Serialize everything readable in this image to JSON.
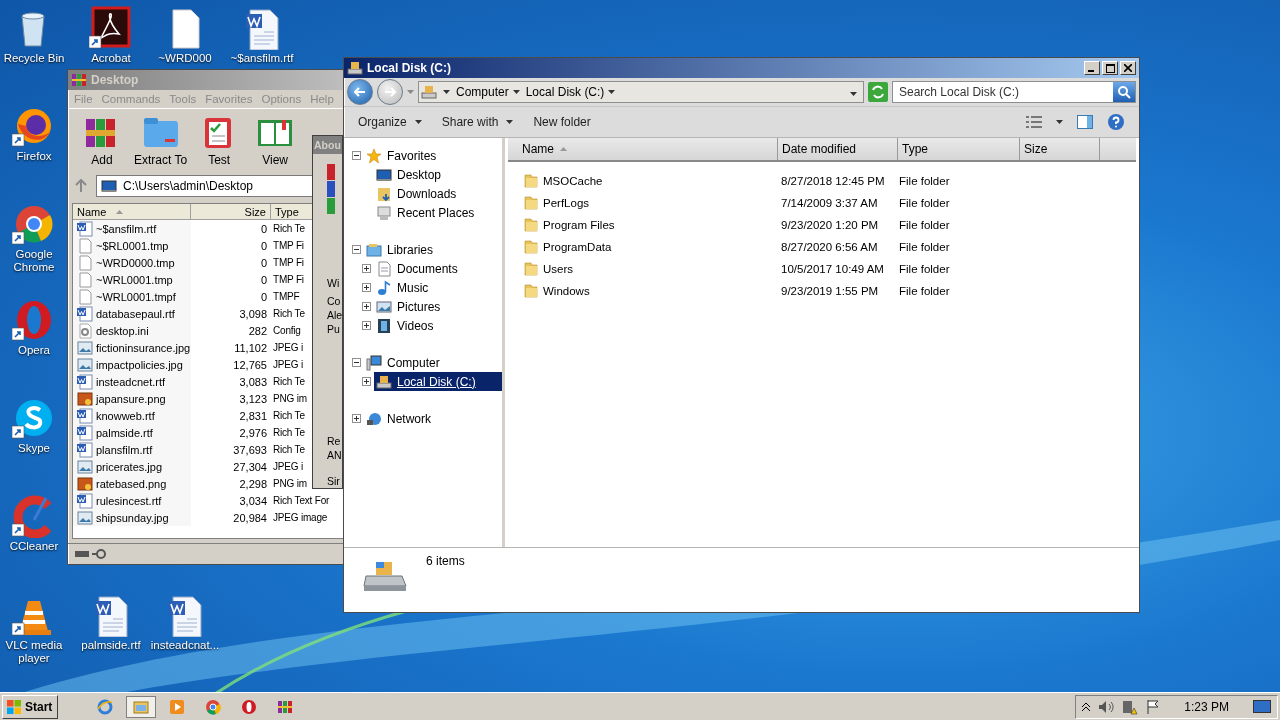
{
  "desktop_icons": [
    {
      "label": "Recycle Bin",
      "kind": "recycle",
      "shortcut": false
    },
    {
      "label": "Acrobat",
      "kind": "acrobat",
      "shortcut": true
    },
    {
      "label": "~WRD000",
      "kind": "blank",
      "shortcut": false
    },
    {
      "label": "~$ansfilm.rtf",
      "kind": "word",
      "shortcut": false
    },
    {
      "label": "Firefox",
      "kind": "firefox",
      "shortcut": true
    },
    {
      "label": "Google Chrome",
      "kind": "chrome",
      "shortcut": true
    },
    {
      "label": "Opera",
      "kind": "opera",
      "shortcut": true
    },
    {
      "label": "Skype",
      "kind": "skype",
      "shortcut": true
    },
    {
      "label": "CCleaner",
      "kind": "ccleaner",
      "shortcut": true
    },
    {
      "label": "VLC media player",
      "kind": "vlc",
      "shortcut": true
    },
    {
      "label": "palmside.rtf",
      "kind": "word",
      "shortcut": false
    },
    {
      "label": "insteadcnat...",
      "kind": "word",
      "shortcut": false
    }
  ],
  "archiver": {
    "title": "Desktop",
    "menu": [
      "File",
      "Commands",
      "Tools",
      "Favorites",
      "Options",
      "Help"
    ],
    "toolbar": [
      {
        "label": "Add",
        "kind": "add"
      },
      {
        "label": "Extract To",
        "kind": "extract"
      },
      {
        "label": "Test",
        "kind": "test"
      },
      {
        "label": "View",
        "kind": "view"
      }
    ],
    "path": "C:\\Users\\admin\\Desktop",
    "columns": [
      "Name",
      "Size",
      "Type"
    ],
    "rows": [
      {
        "name": "~$ansfilm.rtf",
        "kind": "word",
        "size": "0",
        "type": "Rich Te"
      },
      {
        "name": "~$RL0001.tmp",
        "kind": "blank",
        "size": "0",
        "type": "TMP Fi"
      },
      {
        "name": "~WRD0000.tmp",
        "kind": "blank",
        "size": "0",
        "type": "TMP Fi"
      },
      {
        "name": "~WRL0001.tmp",
        "kind": "blank",
        "size": "0",
        "type": "TMP Fi"
      },
      {
        "name": "~WRL0001.tmpf",
        "kind": "blank",
        "size": "0",
        "type": "TMPF"
      },
      {
        "name": "databasepaul.rtf",
        "kind": "word",
        "size": "3,098",
        "type": "Rich Te"
      },
      {
        "name": "desktop.ini",
        "kind": "ini",
        "size": "282",
        "type": "Config"
      },
      {
        "name": "fictioninsurance.jpg",
        "kind": "image",
        "size": "11,102",
        "type": "JPEG i"
      },
      {
        "name": "impactpolicies.jpg",
        "kind": "image",
        "size": "12,765",
        "type": "JPEG i"
      },
      {
        "name": "insteadcnet.rtf",
        "kind": "word",
        "size": "3,083",
        "type": "Rich Te"
      },
      {
        "name": "japansure.png",
        "kind": "png",
        "size": "3,123",
        "type": "PNG im"
      },
      {
        "name": "knowweb.rtf",
        "kind": "word",
        "size": "2,831",
        "type": "Rich Te"
      },
      {
        "name": "palmside.rtf",
        "kind": "word",
        "size": "2,976",
        "type": "Rich Te"
      },
      {
        "name": "plansfilm.rtf",
        "kind": "word",
        "size": "37,693",
        "type": "Rich Te"
      },
      {
        "name": "pricerates.jpg",
        "kind": "image",
        "size": "27,304",
        "type": "JPEG i"
      },
      {
        "name": "ratebased.png",
        "kind": "png",
        "size": "2,298",
        "type": "PNG im"
      },
      {
        "name": "rulesincest.rtf",
        "kind": "word",
        "size": "3,034",
        "type": "Rich Text For"
      },
      {
        "name": "shipsunday.jpg",
        "kind": "image",
        "size": "20,984",
        "type": "JPEG image"
      }
    ]
  },
  "about_dialog": {
    "title": "Abou",
    "groups": [
      [
        "Wi"
      ],
      [
        "Co",
        "Ale",
        "Pu"
      ],
      [
        "Re",
        "AN"
      ],
      [
        "Sir"
      ]
    ]
  },
  "explorer": {
    "title": "Local Disk (C:)",
    "breadcrumbs": [
      "Computer",
      "Local Disk (C:)"
    ],
    "search": {
      "placeholder": "Search Local Disk (C:)"
    },
    "commands": [
      "Organize",
      "Share with",
      "New folder"
    ],
    "nav": [
      {
        "label": "Favorites",
        "kind": "star",
        "expanded": true,
        "selected": false,
        "children": [
          {
            "label": "Desktop",
            "kind": "desktop",
            "selected": false
          },
          {
            "label": "Downloads",
            "kind": "downloads",
            "selected": false
          },
          {
            "label": "Recent Places",
            "kind": "recent",
            "selected": false
          }
        ]
      },
      {
        "label": "Libraries",
        "kind": "library",
        "expanded": true,
        "selected": false,
        "children": [
          {
            "label": "Documents",
            "kind": "documents",
            "expanded": false,
            "selected": false
          },
          {
            "label": "Music",
            "kind": "music",
            "expanded": false,
            "selected": false
          },
          {
            "label": "Pictures",
            "kind": "pictures",
            "expanded": false,
            "selected": false
          },
          {
            "label": "Videos",
            "kind": "videos",
            "expanded": false,
            "selected": false
          }
        ]
      },
      {
        "label": "Computer",
        "kind": "computer",
        "expanded": true,
        "selected": false,
        "children": [
          {
            "label": "Local Disk (C:)",
            "kind": "disk",
            "expanded": false,
            "selected": true
          }
        ]
      },
      {
        "label": "Network",
        "kind": "network",
        "expanded": false,
        "selected": false
      }
    ],
    "columns": [
      "Name",
      "Date modified",
      "Type",
      "Size"
    ],
    "rows": [
      {
        "name": "MSOCache",
        "date": "8/27/2018 12:45 PM",
        "type": "File folder"
      },
      {
        "name": "PerfLogs",
        "date": "7/14/2009 3:37 AM",
        "type": "File folder"
      },
      {
        "name": "Program Files",
        "date": "9/23/2020 1:20 PM",
        "type": "File folder"
      },
      {
        "name": "ProgramData",
        "date": "8/27/2020 6:56 AM",
        "type": "File folder"
      },
      {
        "name": "Users",
        "date": "10/5/2017 10:49 AM",
        "type": "File folder"
      },
      {
        "name": "Windows",
        "date": "9/23/2019 1:55 PM",
        "type": "File folder"
      }
    ],
    "status": "6 items"
  },
  "taskbar": {
    "start": "Start",
    "apps": [
      {
        "kind": "ie",
        "selected": false
      },
      {
        "kind": "explorer",
        "selected": true
      },
      {
        "kind": "media",
        "selected": false
      },
      {
        "kind": "chrome",
        "selected": false
      },
      {
        "kind": "opera",
        "selected": false
      },
      {
        "kind": "winrar",
        "selected": false
      }
    ],
    "clock": "1:23 PM"
  }
}
